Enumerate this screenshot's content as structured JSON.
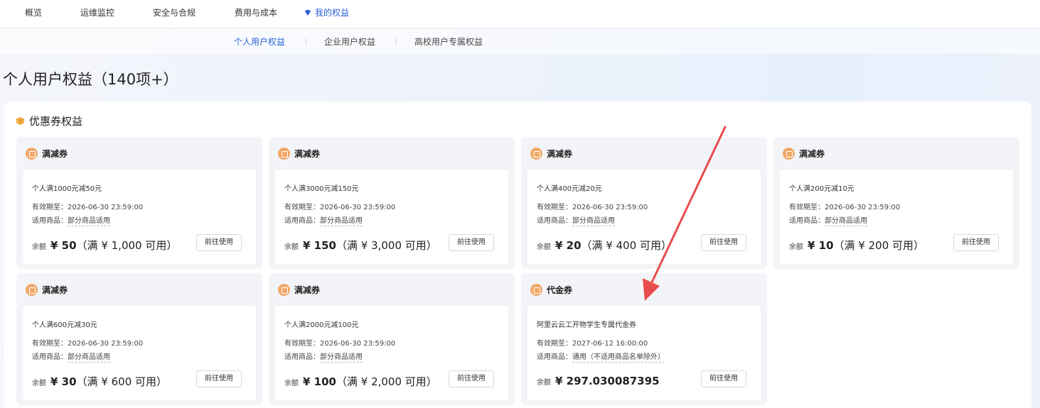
{
  "topnav": {
    "items": [
      {
        "label": "概览"
      },
      {
        "label": "运维监控"
      },
      {
        "label": "安全与合规"
      },
      {
        "label": "费用与成本"
      },
      {
        "label": "我的权益",
        "icon": "diamond-icon",
        "active": true
      }
    ]
  },
  "subnav": {
    "tabs": [
      {
        "label": "个人用户权益",
        "active": true
      },
      {
        "label": "企业用户权益"
      },
      {
        "label": "高校用户专属权益"
      }
    ]
  },
  "page": {
    "title": "个人用户权益（140项+）"
  },
  "section": {
    "title": "优惠券权益",
    "icon": "box-icon"
  },
  "labels": {
    "valid_prefix": "有效期至：",
    "scope_prefix": "适用商品：",
    "balance": "余额",
    "use_button": "前往使用"
  },
  "coupons": [
    {
      "type": "满减券",
      "name": "个人满1000元减50元",
      "valid_until": "2026-06-30 23:59:00",
      "scope": "部分商品适用",
      "amount": "¥ 50",
      "condition": "（满 ¥ 1,000 可用）"
    },
    {
      "type": "满减券",
      "name": "个人满3000元减150元",
      "valid_until": "2026-06-30 23:59:00",
      "scope": "部分商品适用",
      "amount": "¥ 150",
      "condition": "（满 ¥ 3,000 可用）"
    },
    {
      "type": "满减券",
      "name": "个人满400元减20元",
      "valid_until": "2026-06-30 23:59:00",
      "scope": "部分商品适用",
      "amount": "¥ 20",
      "condition": "（满 ¥ 400 可用）"
    },
    {
      "type": "满减券",
      "name": "个人满200元减10元",
      "valid_until": "2026-06-30 23:59:00",
      "scope": "部分商品适用",
      "amount": "¥ 10",
      "condition": "（满 ¥ 200 可用）"
    },
    {
      "type": "满减券",
      "name": "个人满600元减30元",
      "valid_until": "2026-06-30 23:59:00",
      "scope": "部分商品适用",
      "amount": "¥ 30",
      "condition": "（满 ¥ 600 可用）"
    },
    {
      "type": "满减券",
      "name": "个人满2000元减100元",
      "valid_until": "2026-06-30 23:59:00",
      "scope": "部分商品适用",
      "amount": "¥ 100",
      "condition": "（满 ¥ 2,000 可用）"
    },
    {
      "type": "代金券",
      "name": "阿里云云工开物学生专属代金券",
      "valid_until": "2027-06-12 16:00:00",
      "scope": "通用（不适用商品名单除外）",
      "amount": "¥ 297.030087395",
      "condition": ""
    }
  ],
  "colors": {
    "accent": "#2a62d8",
    "coupon_icon": "#f1a869",
    "annotation_arrow": "#e84c4c"
  }
}
